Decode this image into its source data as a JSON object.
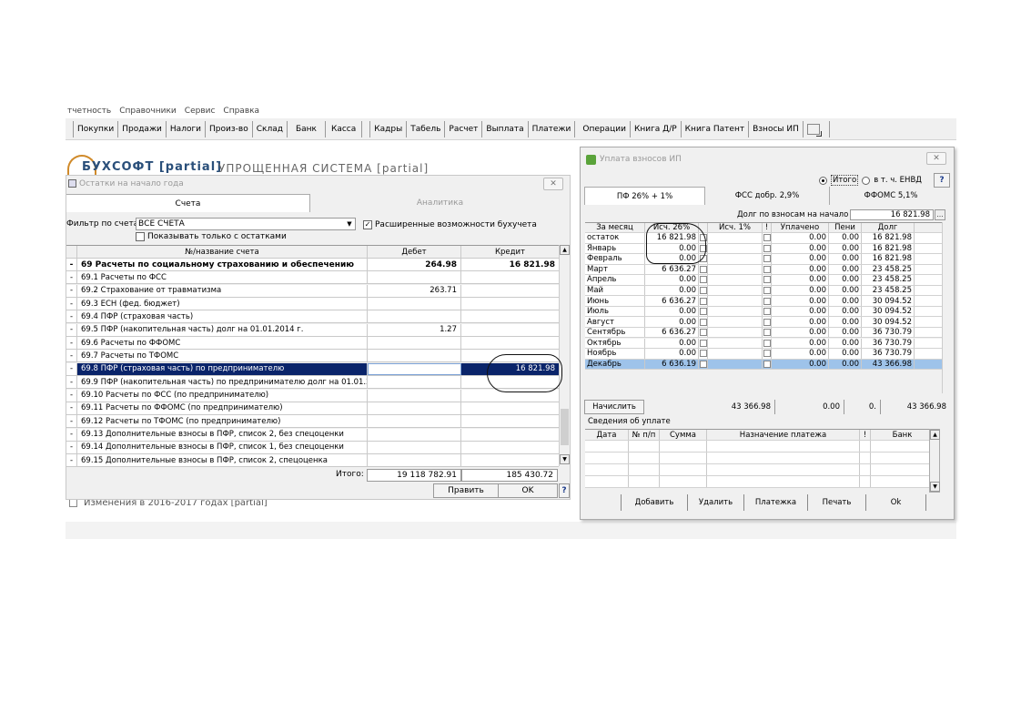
{
  "menu": [
    "тчетность",
    "Справочники",
    "Сервис",
    "Справка"
  ],
  "toolbar": {
    "buttons": [
      "Покупки",
      "Продажи",
      "Налоги",
      "Произ-во",
      "Склад",
      "Банк",
      "Касса"
    ],
    "buttons2": [
      "Кадры",
      "Табель",
      "Расчет",
      "Выплата",
      "Платежи"
    ],
    "buttons3": [
      "Операции",
      "Книга Д/Р",
      "Книга Патент",
      "Взносы ИП"
    ]
  },
  "background": {
    "logo": "БУХСОФТ [partial]",
    "slogan": "УПРОЩЕННАЯ СИСТЕМА [partial]",
    "bottom_text": "Изменения в 2016-2017 годах [partial]"
  },
  "window1": {
    "title": "Остатки на начало года",
    "close": "✕",
    "tabs": [
      "Счета",
      "Аналитика"
    ],
    "filter_label": "Фильтр по счетам",
    "filter_value": "ВСЕ СЧЕТА",
    "extended_label": "Расширенные возможности бухучета",
    "only_rest_label": "Показывать только с остатками",
    "columns": {
      "name": "№/название счета",
      "debit": "Дебет",
      "credit": "Кредит"
    },
    "rows": [
      {
        "mark": "-",
        "name": "69 Расчеты по социальному страхованию и обеспечению",
        "debit": "264.98",
        "credit": "16 821.98"
      },
      {
        "mark": "-",
        "name": "69.1  Расчеты по ФСС",
        "debit": "",
        "credit": ""
      },
      {
        "mark": "-",
        "name": "69.2  Страхование от травматизма",
        "debit": "263.71",
        "credit": ""
      },
      {
        "mark": "-",
        "name": "69.3  ЕСН (фед. бюджет)",
        "debit": "",
        "credit": ""
      },
      {
        "mark": "-",
        "name": "69.4  ПФР (страховая часть)",
        "debit": "",
        "credit": ""
      },
      {
        "mark": "-",
        "name": "69.5  ПФР (накопительная часть) долг на 01.01.2014 г.",
        "debit": "1.27",
        "credit": ""
      },
      {
        "mark": "-",
        "name": "69.6  Расчеты по ФФОМС",
        "debit": "",
        "credit": ""
      },
      {
        "mark": "-",
        "name": "69.7  Расчеты по ТФОМС",
        "debit": "",
        "credit": ""
      },
      {
        "mark": "-",
        "name": "69.8  ПФР (страховая часть) по предпринимателю",
        "debit": "",
        "credit": "16 821.98"
      },
      {
        "mark": "-",
        "name": "69.9  ПФР (накопительная часть) по предпринимателю долг на 01.01.2014 г.",
        "debit": "",
        "credit": ""
      },
      {
        "mark": "-",
        "name": "69.10 Расчеты по ФСС (по предпринимателю)",
        "debit": "",
        "credit": ""
      },
      {
        "mark": "-",
        "name": "69.11 Расчеты по ФФОМС (по предпринимателю)",
        "debit": "",
        "credit": ""
      },
      {
        "mark": "-",
        "name": "69.12 Расчеты по ТФОМС (по предпринимателю)",
        "debit": "",
        "credit": ""
      },
      {
        "mark": "-",
        "name": "69.13 Дополнительные взносы в ПФР, список 2, без спецоценки",
        "debit": "",
        "credit": ""
      },
      {
        "mark": "-",
        "name": "69.14 Дополнительные взносы в ПФР, список 1, без спецоценки",
        "debit": "",
        "credit": ""
      },
      {
        "mark": "-",
        "name": "69.15 Дополнительные взносы в ПФР, список 2, спецоценка",
        "debit": "",
        "credit": ""
      }
    ],
    "totals_label": "Итого:",
    "totals_debit": "19 118 782.91",
    "totals_credit": "185 430.72",
    "edit_button": "Править",
    "ok_button": "OK",
    "help_button": "?"
  },
  "window2": {
    "title": "Уплата взносов ИП",
    "close": "✕",
    "radio_total": "Итого",
    "radio_envd": "в т. ч. ЕНВД",
    "help_button": "?",
    "fund_tabs": [
      "ПФ 26% + 1%",
      "ФСС добр. 2,9%",
      "ФФОМС 5,1%"
    ],
    "debt_label": "Долг по взносам на начало года",
    "debt_value": "16 821.98",
    "columns": {
      "month": "За месяц",
      "acc26": "Исч. 26%",
      "acc1": "Исч. 1%",
      "flag": "!",
      "paid": "Уплачено",
      "penalty": "Пени",
      "debt": "Долг"
    },
    "rows": [
      {
        "month": "остаток",
        "acc26": "16 821.98",
        "acc1": "",
        "paid": "0.00",
        "penalty": "0.00",
        "debt": "16 821.98"
      },
      {
        "month": "Январь",
        "acc26": "0.00",
        "acc1": "",
        "paid": "0.00",
        "penalty": "0.00",
        "debt": "16 821.98"
      },
      {
        "month": "Февраль",
        "acc26": "0.00",
        "acc1": "",
        "paid": "0.00",
        "penalty": "0.00",
        "debt": "16 821.98"
      },
      {
        "month": "Март",
        "acc26": "6 636.27",
        "acc1": "",
        "paid": "0.00",
        "penalty": "0.00",
        "debt": "23 458.25"
      },
      {
        "month": "Апрель",
        "acc26": "0.00",
        "acc1": "",
        "paid": "0.00",
        "penalty": "0.00",
        "debt": "23 458.25"
      },
      {
        "month": "Май",
        "acc26": "0.00",
        "acc1": "",
        "paid": "0.00",
        "penalty": "0.00",
        "debt": "23 458.25"
      },
      {
        "month": "Июнь",
        "acc26": "6 636.27",
        "acc1": "",
        "paid": "0.00",
        "penalty": "0.00",
        "debt": "30 094.52"
      },
      {
        "month": "Июль",
        "acc26": "0.00",
        "acc1": "",
        "paid": "0.00",
        "penalty": "0.00",
        "debt": "30 094.52"
      },
      {
        "month": "Август",
        "acc26": "0.00",
        "acc1": "",
        "paid": "0.00",
        "penalty": "0.00",
        "debt": "30 094.52"
      },
      {
        "month": "Сентябрь",
        "acc26": "6 636.27",
        "acc1": "",
        "paid": "0.00",
        "penalty": "0.00",
        "debt": "36 730.79"
      },
      {
        "month": "Октябрь",
        "acc26": "0.00",
        "acc1": "",
        "paid": "0.00",
        "penalty": "0.00",
        "debt": "36 730.79"
      },
      {
        "month": "Ноябрь",
        "acc26": "0.00",
        "acc1": "",
        "paid": "0.00",
        "penalty": "0.00",
        "debt": "36 730.79"
      },
      {
        "month": "Декабрь",
        "acc26": "6 636.19",
        "acc1": "",
        "paid": "0.00",
        "penalty": "0.00",
        "debt": "43 366.98"
      }
    ],
    "calc_button": "Начислить",
    "calc_acc26": "43 366.98",
    "calc_paid": "0.00",
    "calc_penalty": "0.",
    "calc_debt": "43 366.98",
    "pay_info_title": "Сведения об уплате",
    "pay_columns": {
      "date": "Дата",
      "num": "№ п/п",
      "sum": "Сумма",
      "purpose": "Назначение платежа",
      "flag": "!",
      "bank": "Банк"
    },
    "buttons": {
      "add": "Добавить",
      "delete": "Удалить",
      "payment": "Платежка",
      "print": "Печать",
      "ok": "Ok"
    }
  },
  "colors": {
    "selection": "#0a246a",
    "row_highlight": "#9ec3ea",
    "accent_link": "#1a3a8a"
  }
}
